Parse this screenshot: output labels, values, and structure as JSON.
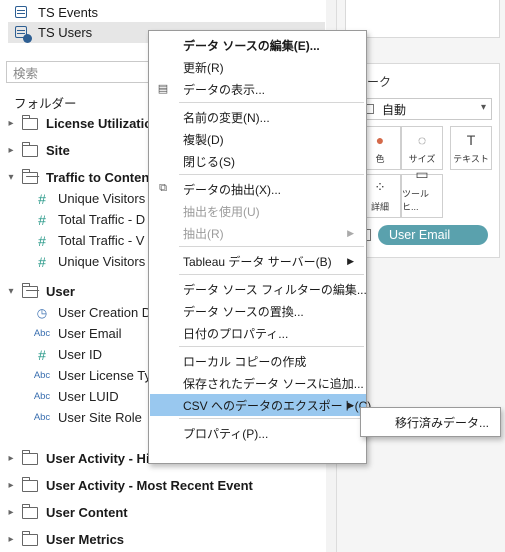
{
  "connections": [
    {
      "label": "TS Events",
      "selected": false
    },
    {
      "label": "TS Users",
      "selected": true
    }
  ],
  "search": {
    "placeholder": "検索"
  },
  "folders_label": "フォルダー",
  "tree": [
    {
      "type": "folder",
      "label": "License Utilization",
      "open": false
    },
    {
      "type": "folder",
      "label": "Site",
      "open": false
    },
    {
      "type": "folder",
      "label": "Traffic to Content",
      "open": true
    },
    {
      "type": "field",
      "icon": "#",
      "label": "Unique Visitors"
    },
    {
      "type": "field",
      "icon": "#",
      "label": "Total Traffic - D"
    },
    {
      "type": "field",
      "icon": "#",
      "label": "Total Traffic - V"
    },
    {
      "type": "field",
      "icon": "#",
      "label": "Unique Visitors"
    },
    {
      "type": "folder",
      "label": "User",
      "open": true
    },
    {
      "type": "field",
      "icon": "date",
      "label": "User Creation D"
    },
    {
      "type": "field",
      "icon": "Abc",
      "label": "User Email"
    },
    {
      "type": "field",
      "icon": "#",
      "label": "User ID"
    },
    {
      "type": "field",
      "icon": "Abc",
      "label": "User License Ty"
    },
    {
      "type": "field",
      "icon": "Abc",
      "label": "User LUID"
    },
    {
      "type": "field",
      "icon": "Abc",
      "label": "User Site Role"
    },
    {
      "type": "folder",
      "label": "User Activity - Historical",
      "open": false
    },
    {
      "type": "folder",
      "label": "User Activity - Most Recent Event",
      "open": false
    },
    {
      "type": "folder",
      "label": "User Content",
      "open": false
    },
    {
      "type": "folder",
      "label": "User Metrics",
      "open": false
    }
  ],
  "marks": {
    "title": "ーク",
    "mark_type": "自動",
    "buttons": [
      {
        "label": "色",
        "glyph": "●"
      },
      {
        "label": "サイズ",
        "glyph": "◌"
      },
      {
        "label": "テキスト",
        "glyph": "T"
      },
      {
        "label": "詳細",
        "glyph": "⁘"
      },
      {
        "label": "ツールヒ...",
        "glyph": "▭"
      }
    ],
    "pill": "User Email"
  },
  "context_menu": {
    "items": [
      {
        "label": "データ ソースの編集(E)...",
        "bold": true
      },
      {
        "label": "更新(R)"
      },
      {
        "label": "データの表示...",
        "icon": "table-icon"
      },
      {
        "separator": true
      },
      {
        "label": "名前の変更(N)..."
      },
      {
        "label": "複製(D)"
      },
      {
        "label": "閉じる(S)"
      },
      {
        "separator": true
      },
      {
        "label": "データの抽出(X)...",
        "icon": "extract-icon"
      },
      {
        "label": "抽出を使用(U)",
        "disabled": true
      },
      {
        "label": "抽出(R)",
        "disabled": true,
        "submenu": true
      },
      {
        "separator": true
      },
      {
        "label": "Tableau データ サーバー(B)",
        "submenu": true
      },
      {
        "separator": true
      },
      {
        "label": "データ ソース フィルターの編集..."
      },
      {
        "label": "データ ソースの置換..."
      },
      {
        "label": "日付のプロパティ..."
      },
      {
        "separator": true
      },
      {
        "label": "ローカル コピーの作成"
      },
      {
        "label": "保存されたデータ ソースに追加..."
      },
      {
        "label": "CSV へのデータのエクスポート(C)",
        "submenu": true,
        "highlight": true
      },
      {
        "separator": true
      },
      {
        "label": "プロパティ(P)..."
      }
    ],
    "submenu_items": [
      {
        "label": "移行済みデータ..."
      }
    ]
  },
  "colors": {
    "menu_highlight": "#99c8ef",
    "pill": "#5aa1ad",
    "connection_icon": "#2e5f93",
    "selection_bg": "#e6e6e6"
  }
}
